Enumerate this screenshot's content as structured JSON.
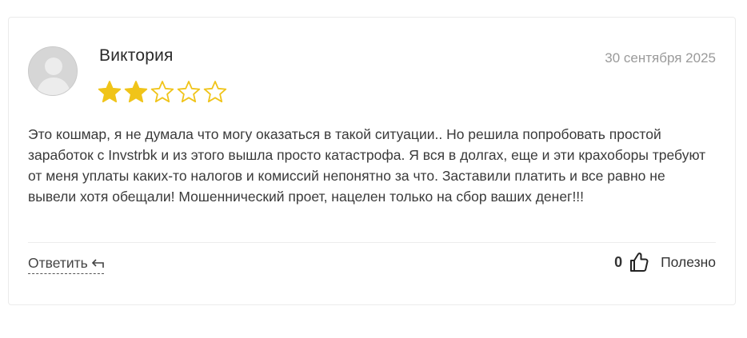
{
  "review": {
    "author": "Виктория",
    "date": "30 сентября 2025",
    "rating": 2,
    "rating_max": 5,
    "text": "Это кошмар, я не думала что могу оказаться в такой ситуации.. Но решила попробовать простой заработок с Invstrbk и из этого вышла просто катастрофа. Я вся в долгах, еще и эти крахоборы требуют от меня уплаты каких-то налогов и комиссий непонятно за что. Заставили платить и все равно не вывели хотя обещали! Мошеннический проет, нацелен только на сбор ваших денег!!!",
    "reply_label": "Ответить",
    "helpful_count": "0",
    "helpful_label": "Полезно"
  },
  "icons": {
    "avatar": "user-avatar-placeholder",
    "star_filled": "star-filled-icon",
    "star_empty": "star-outline-icon",
    "reply": "reply-arrow-icon",
    "like": "thumbs-up-icon"
  },
  "colors": {
    "star": "#f0c419",
    "border": "#ebebeb",
    "date": "#9a9a9a",
    "text": "#3a3a3a"
  }
}
